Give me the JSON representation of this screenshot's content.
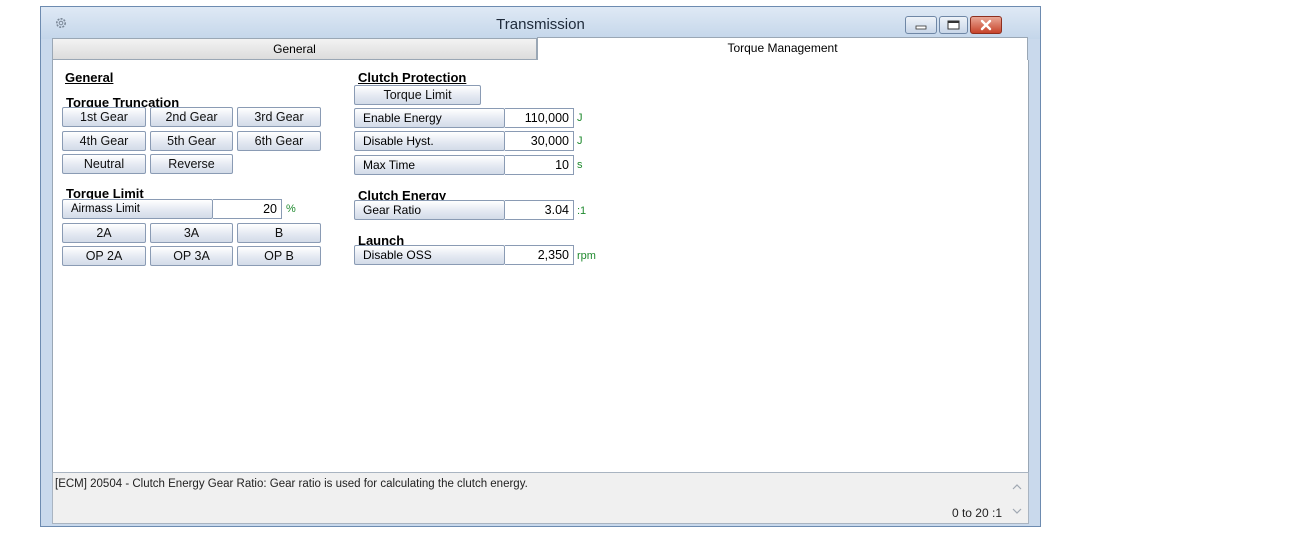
{
  "window": {
    "title": "Transmission"
  },
  "tabs": [
    {
      "label": "General",
      "active": false
    },
    {
      "label": "Torque Management",
      "active": true
    }
  ],
  "left": {
    "heading": "General",
    "torque_truncation": {
      "heading": "Torque Truncation",
      "buttons": [
        "1st Gear",
        "2nd Gear",
        "3rd Gear",
        "4th Gear",
        "5th Gear",
        "6th Gear",
        "Neutral",
        "Reverse"
      ]
    },
    "torque_limit": {
      "heading": "Torque Limit",
      "airmass": {
        "label": "Airmass Limit",
        "value": "20",
        "unit": "%"
      },
      "buttons": [
        "2A",
        "3A",
        "B",
        "OP 2A",
        "OP 3A",
        "OP B"
      ]
    }
  },
  "right": {
    "clutch_protection": {
      "heading": "Clutch Protection",
      "torque_limit_button": "Torque Limit",
      "fields": [
        {
          "label": "Enable Energy",
          "value": "110,000",
          "unit": "J"
        },
        {
          "label": "Disable Hyst.",
          "value": "30,000",
          "unit": "J"
        },
        {
          "label": "Max Time",
          "value": "10",
          "unit": "s"
        }
      ]
    },
    "clutch_energy": {
      "heading": "Clutch Energy",
      "fields": [
        {
          "label": "Gear Ratio",
          "value": "3.04",
          "unit": ":1"
        }
      ]
    },
    "launch": {
      "heading": "Launch",
      "fields": [
        {
          "label": "Disable OSS",
          "value": "2,350",
          "unit": "rpm"
        }
      ]
    }
  },
  "status": {
    "description": "[ECM] 20504 - Clutch Energy Gear Ratio: Gear ratio is used for calculating the clutch energy.",
    "range": "0 to 20 :1"
  },
  "icons": {
    "app": "gear-icon",
    "minimize": "minimize-icon",
    "maximize": "maximize-icon",
    "close": "close-icon",
    "scroll_up": "chevron-up-icon",
    "scroll_down": "chevron-down-icon"
  }
}
